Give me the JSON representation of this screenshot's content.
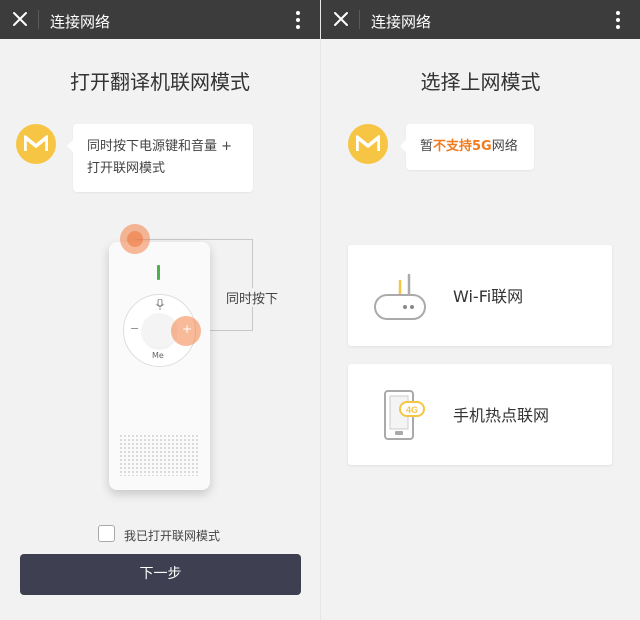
{
  "left": {
    "window_title": "连接网络",
    "heading": "打开翻译机联网模式",
    "instruction_line1": "同时按下电源键和音量 +",
    "instruction_line2": "打开联网模式",
    "simultaneous_label": "同时按下",
    "device": {
      "minus": "−",
      "plus": "+",
      "me": "Me"
    },
    "checkbox_label": "我已打开联网模式",
    "checkbox_checked": false,
    "next_button": "下一步"
  },
  "right": {
    "window_title": "连接网络",
    "heading": "选择上网模式",
    "notice_prefix": "暂",
    "notice_highlight": "不支持5G",
    "notice_suffix": "网络",
    "options": [
      {
        "label": "Wi-Fi联网",
        "icon": "router-icon"
      },
      {
        "label": "手机热点联网",
        "icon": "phone-4g-icon",
        "badge": "4G"
      }
    ]
  },
  "colors": {
    "title_bar": "#3c3c3c",
    "avatar": "#f6c544",
    "highlight": "#f07c1e",
    "primary_button": "#3e3f50",
    "press_indicator": "#f28246",
    "led": "#4caf50"
  }
}
